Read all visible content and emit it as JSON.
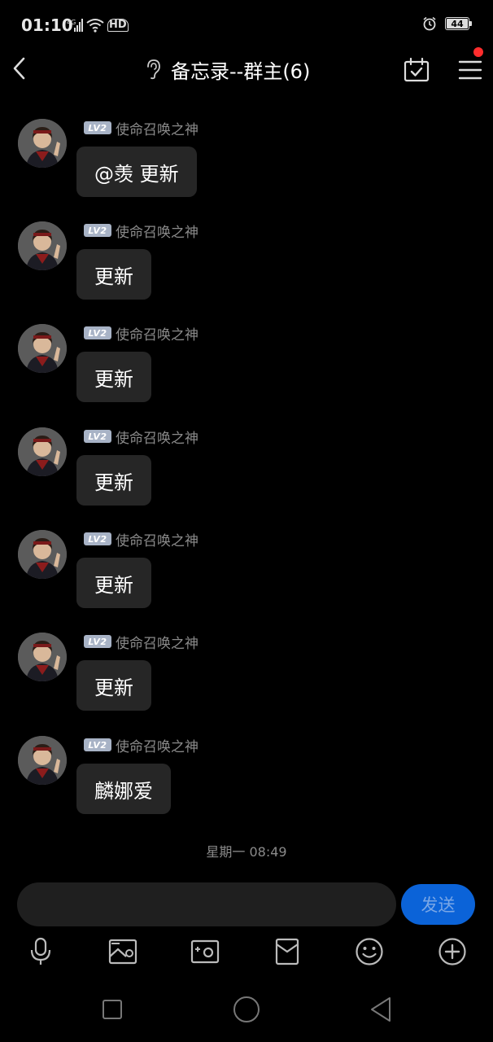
{
  "status_bar": {
    "time": "01:10",
    "network": "4G",
    "hd": "HD",
    "battery": "44"
  },
  "header": {
    "title": "备忘录--群主(6)"
  },
  "messages": [
    {
      "level": "LV2",
      "sender": "使命召唤之神",
      "text": "@羡 更新"
    },
    {
      "level": "LV2",
      "sender": "使命召唤之神",
      "text": "更新"
    },
    {
      "level": "LV2",
      "sender": "使命召唤之神",
      "text": "更新"
    },
    {
      "level": "LV2",
      "sender": "使命召唤之神",
      "text": "更新"
    },
    {
      "level": "LV2",
      "sender": "使命召唤之神",
      "text": "更新"
    },
    {
      "level": "LV2",
      "sender": "使命召唤之神",
      "text": "更新"
    },
    {
      "level": "LV2",
      "sender": "使命召唤之神",
      "text": "麟娜爱"
    }
  ],
  "timestamp": "星期一 08:49",
  "composer": {
    "input_value": "",
    "send_label": "发送"
  },
  "toolbar_icons": [
    "microphone-icon",
    "image-icon",
    "camera-icon",
    "red-packet-icon",
    "emoji-icon",
    "plus-icon"
  ],
  "colors": {
    "background": "#000000",
    "bubble": "#262626",
    "send_button": "#0b63d8",
    "badge": "#a8b3c6",
    "notification_dot": "#ff2d2d"
  }
}
